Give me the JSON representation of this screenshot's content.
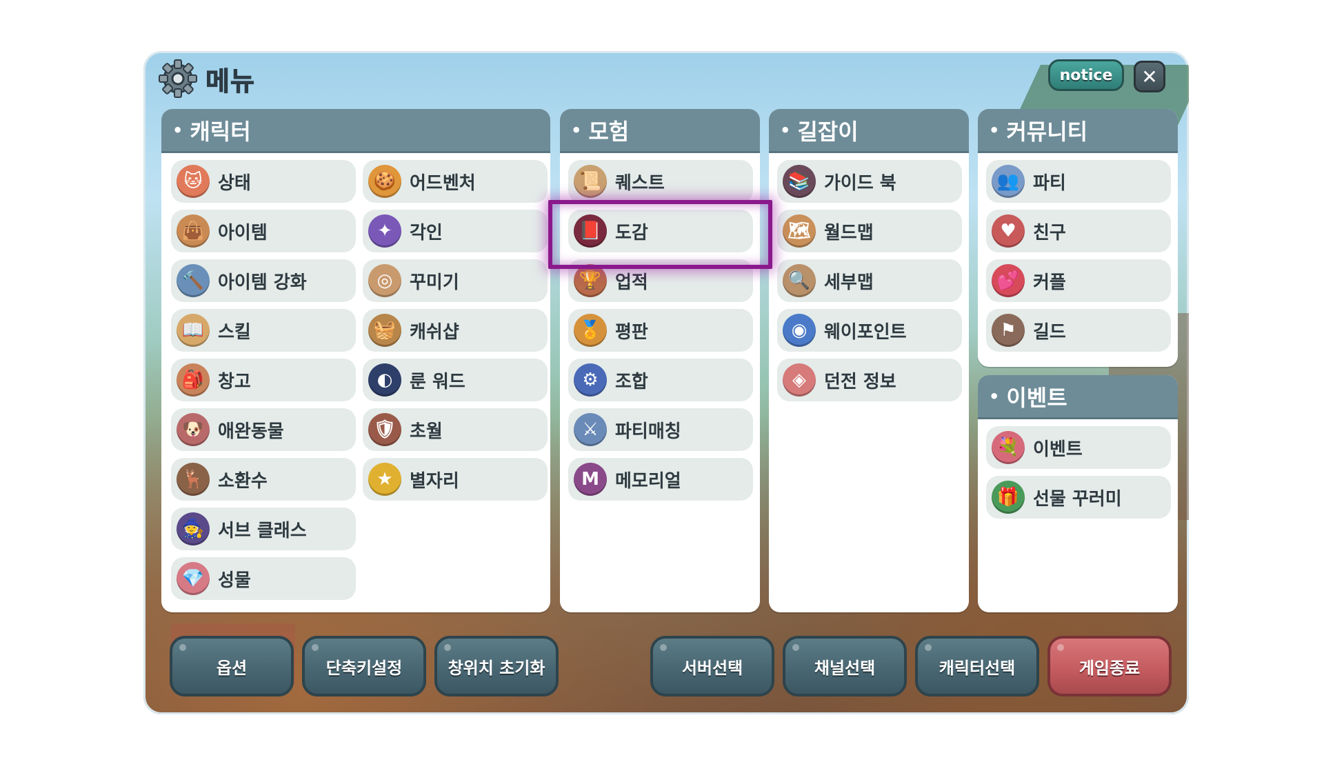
{
  "window": {
    "title": "메뉴",
    "notice_label": "notice",
    "close_label": "✕"
  },
  "colors": {
    "panel_header": "#6e8c98",
    "item_bg": "#e4ebe9",
    "highlight": "#8a1a8c",
    "exit_button": "#c25a5e"
  },
  "sections": {
    "character": {
      "title": "캐릭터",
      "items": [
        {
          "label": "상태",
          "icon": "cat-status-icon"
        },
        {
          "label": "어드벤처",
          "icon": "cookie-adventure-icon"
        },
        {
          "label": "아이템",
          "icon": "item-bag-icon"
        },
        {
          "label": "각인",
          "icon": "star-engrave-icon"
        },
        {
          "label": "아이템 강화",
          "icon": "hammer-enhance-icon"
        },
        {
          "label": "꾸미기",
          "icon": "cosmetic-icon"
        },
        {
          "label": "스킬",
          "icon": "skill-book-icon"
        },
        {
          "label": "캐쉬샵",
          "icon": "cash-shop-icon"
        },
        {
          "label": "창고",
          "icon": "storage-bag-icon"
        },
        {
          "label": "룬 워드",
          "icon": "rune-word-icon"
        },
        {
          "label": "애완동물",
          "icon": "pet-icon"
        },
        {
          "label": "초월",
          "icon": "transcend-shield-icon"
        },
        {
          "label": "소환수",
          "icon": "summon-icon"
        },
        {
          "label": "별자리",
          "icon": "constellation-star-icon"
        },
        {
          "label": "서브 클래스",
          "icon": "subclass-icon"
        },
        {
          "label": "성물",
          "icon": "relic-icon"
        }
      ]
    },
    "adventure": {
      "title": "모험",
      "items": [
        {
          "label": "퀘스트",
          "icon": "quest-scroll-icon"
        },
        {
          "label": "도감",
          "icon": "collection-book-icon"
        },
        {
          "label": "업적",
          "icon": "achievement-icon"
        },
        {
          "label": "평판",
          "icon": "reputation-medal-icon"
        },
        {
          "label": "조합",
          "icon": "crafting-gear-icon"
        },
        {
          "label": "파티매칭",
          "icon": "party-matching-icon"
        },
        {
          "label": "메모리얼",
          "icon": "memorial-icon"
        }
      ]
    },
    "guide": {
      "title": "길잡이",
      "items": [
        {
          "label": "가이드 북",
          "icon": "guide-book-icon"
        },
        {
          "label": "월드맵",
          "icon": "world-map-icon"
        },
        {
          "label": "세부맵",
          "icon": "detail-map-icon"
        },
        {
          "label": "웨이포인트",
          "icon": "waypoint-orb-icon"
        },
        {
          "label": "던전 정보",
          "icon": "dungeon-info-icon"
        }
      ]
    },
    "community": {
      "title": "커뮤니티",
      "items": [
        {
          "label": "파티",
          "icon": "party-icon"
        },
        {
          "label": "친구",
          "icon": "friend-icon"
        },
        {
          "label": "커플",
          "icon": "couple-icon"
        },
        {
          "label": "길드",
          "icon": "guild-flag-icon"
        }
      ]
    },
    "event": {
      "title": "이벤트",
      "items": [
        {
          "label": "이벤트",
          "icon": "event-bouquet-icon"
        },
        {
          "label": "선물 꾸러미",
          "icon": "gift-box-icon"
        }
      ]
    }
  },
  "bottom_buttons": [
    {
      "label": "옵션"
    },
    {
      "label": "단축키설정"
    },
    {
      "label": "창위치 초기화"
    },
    {
      "label": "서버선택"
    },
    {
      "label": "채널선택"
    },
    {
      "label": "캐릭터선택"
    },
    {
      "label": "게임종료"
    }
  ]
}
